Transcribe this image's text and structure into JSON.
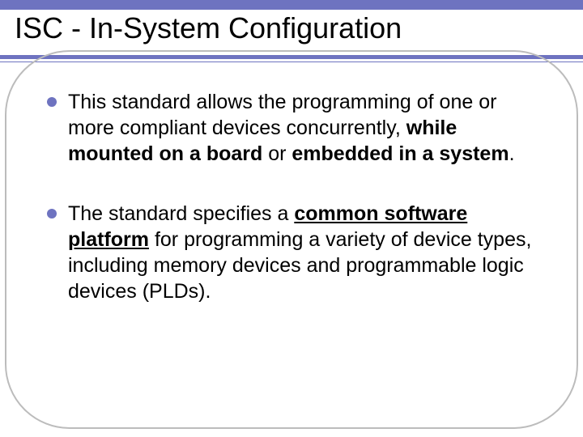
{
  "title": "ISC - In-System Configuration",
  "bullets": [
    {
      "pre": "This standard allows the programming of one or more compliant devices concurrently, ",
      "bold1": "while mounted on a board",
      "mid": " or ",
      "bold2": "embedded in a system",
      "post": "."
    },
    {
      "pre": "The standard specifies a ",
      "bu": "common software platform",
      "post": " for programming a variety of device types, including memory devices and programmable logic devices (PLDs)."
    }
  ]
}
